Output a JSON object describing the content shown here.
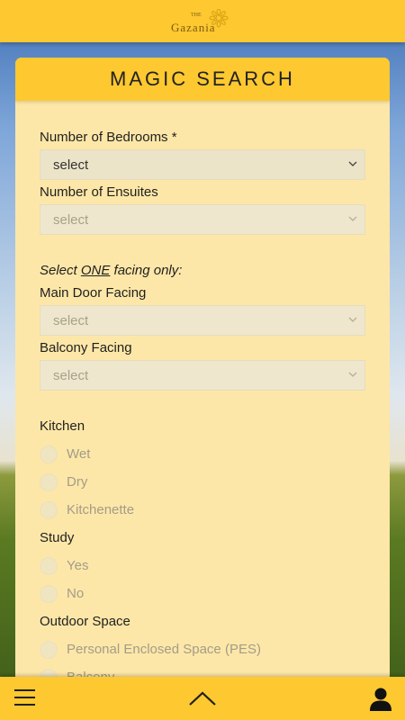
{
  "header": {
    "logo_the": "THE",
    "logo_word": "Gazania"
  },
  "card": {
    "title": "MAGIC SEARCH"
  },
  "form": {
    "bedrooms_label": "Number of Bedrooms *",
    "bedrooms_value": "select",
    "ensuites_label": "Number of Ensuites",
    "ensuites_value": "select",
    "facing_note_pre": "Select ",
    "facing_note_emph": "ONE",
    "facing_note_post": " facing only:",
    "main_door_label": "Main Door Facing",
    "main_door_value": "select",
    "balcony_label": "Balcony Facing",
    "balcony_value": "select",
    "kitchen_label": "Kitchen",
    "kitchen_options": [
      "Wet",
      "Dry",
      "Kitchenette"
    ],
    "study_label": "Study",
    "study_options": [
      "Yes",
      "No"
    ],
    "outdoor_label": "Outdoor Space",
    "outdoor_options": [
      "Personal Enclosed Space (PES)",
      "Balcony"
    ]
  },
  "colors": {
    "accent": "#fdc830",
    "card_bg": "#fde7a8"
  },
  "icons": {
    "menu": "hamburger-icon",
    "up": "chevron-up-icon",
    "user": "user-icon",
    "dropdown": "chevron-down-icon"
  }
}
